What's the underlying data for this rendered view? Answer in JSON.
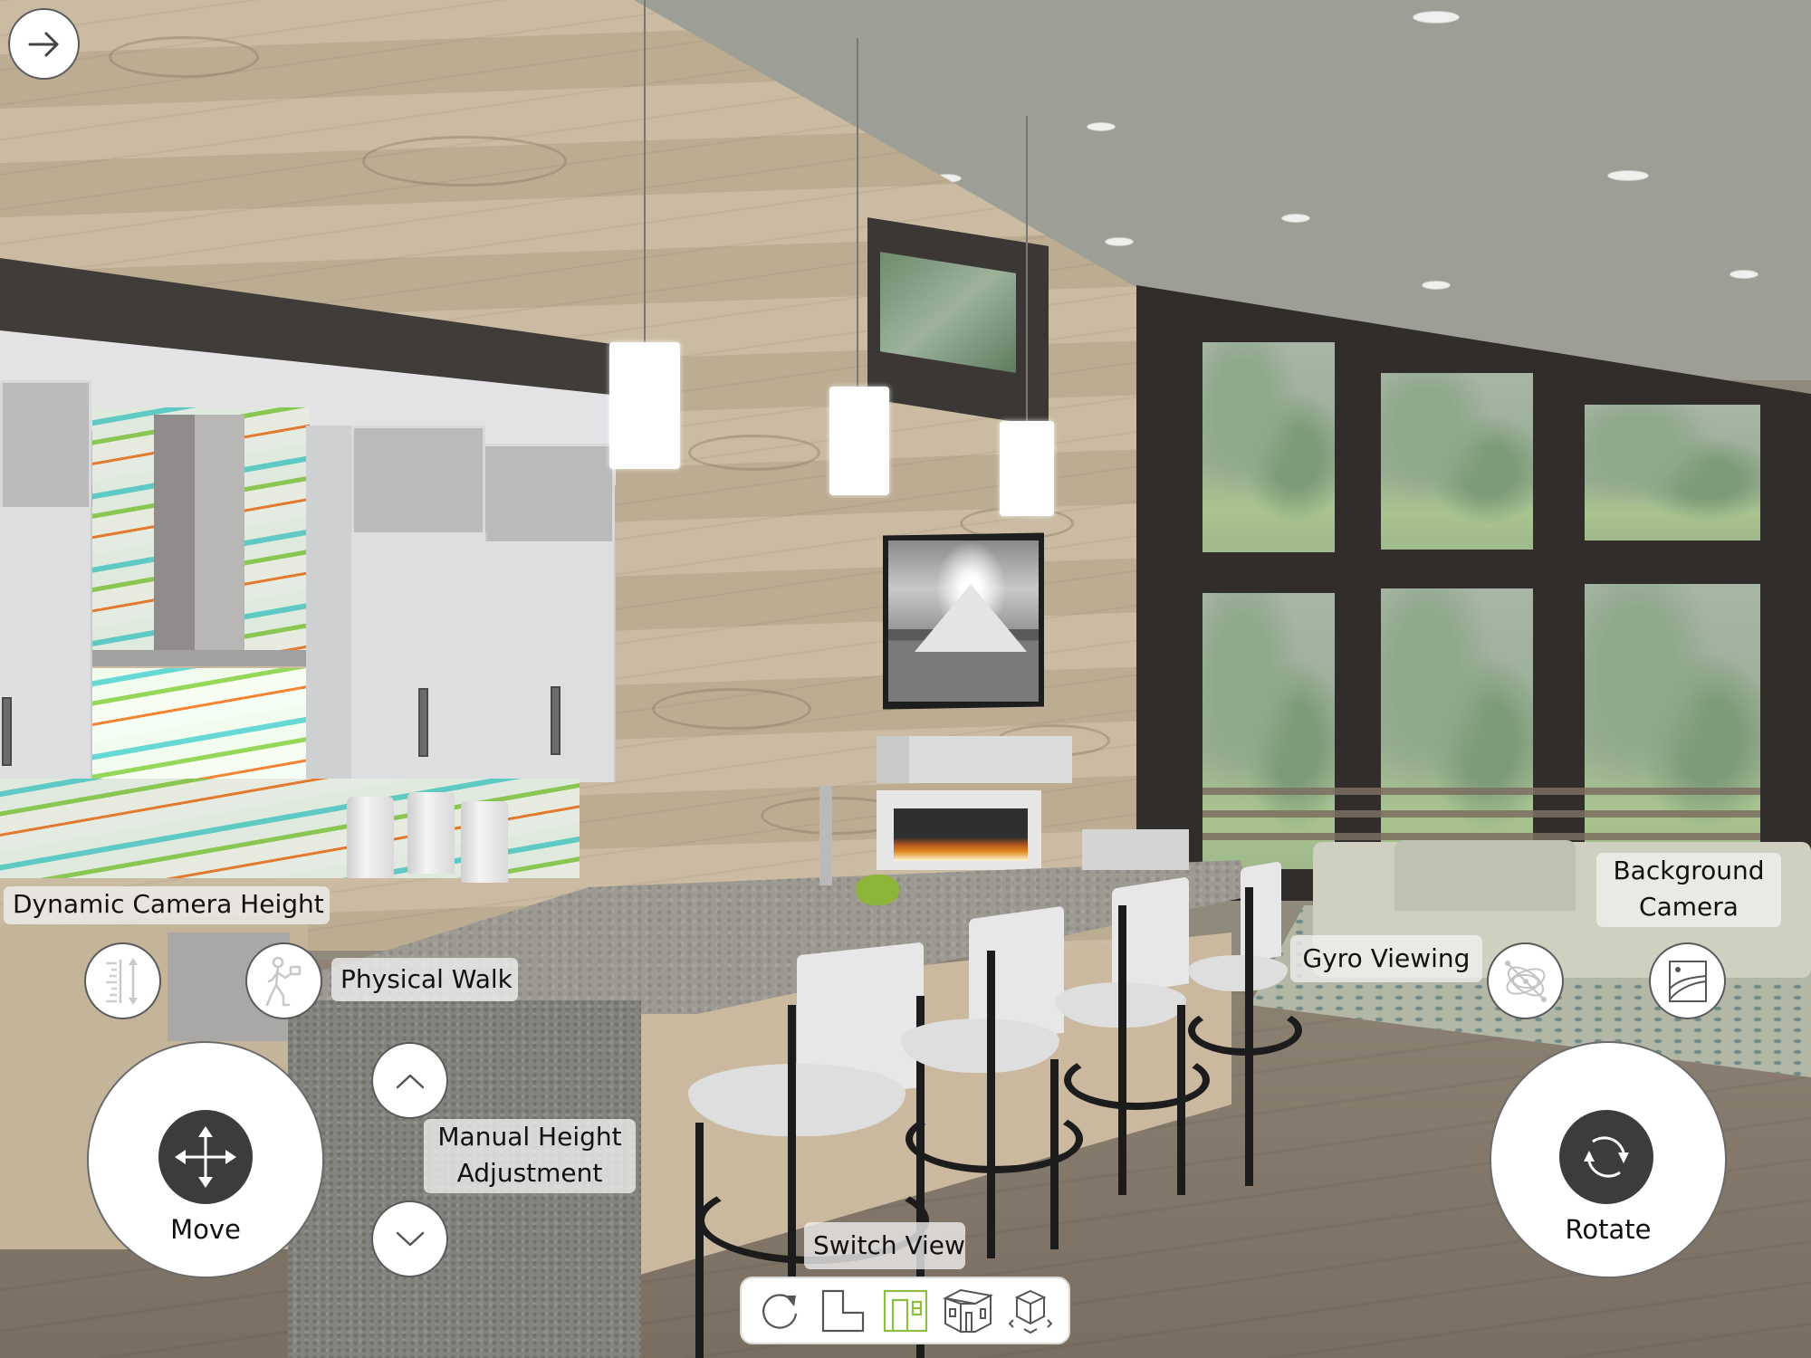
{
  "app": {
    "view_mode": "3D walkthrough",
    "scene_description": "Kitchen with island, bar stools, wood plank accent wall, fireplace, and floor-to-ceiling windows"
  },
  "nav": {
    "back_button_icon": "arrow-right-icon"
  },
  "controls": {
    "dynamic_camera_height": {
      "label": "Dynamic Camera Height",
      "icon": "height-ruler-icon"
    },
    "physical_walk": {
      "label": "Physical Walk",
      "icon": "walking-person-icon"
    },
    "move": {
      "label": "Move",
      "icon": "move-arrows-icon"
    },
    "manual_height": {
      "label_line1": "Manual Height",
      "label_line2": "Adjustment",
      "up_icon": "chevron-up-icon",
      "down_icon": "chevron-down-icon"
    },
    "switch_view": {
      "label": "Switch View",
      "views": [
        {
          "name": "reset-view",
          "icon": "rotate-reset-icon",
          "active": false
        },
        {
          "name": "floor-plan",
          "icon": "floor-plan-icon",
          "active": false
        },
        {
          "name": "elevation",
          "icon": "elevation-icon",
          "active": true
        },
        {
          "name": "3d-house",
          "icon": "house-3d-icon",
          "active": false
        },
        {
          "name": "3d-object",
          "icon": "cube-3d-icon",
          "active": false
        }
      ],
      "active_color": "#8cbf3f",
      "inactive_color": "#555555"
    },
    "gyro_viewing": {
      "label": "Gyro Viewing",
      "icon": "gyroscope-icon"
    },
    "background_camera": {
      "label_line1": "Background",
      "label_line2": "Camera",
      "icon": "landscape-image-icon"
    },
    "rotate": {
      "label": "Rotate",
      "icon": "rotate-arrows-icon"
    }
  },
  "colors": {
    "button_bg": "#ffffff",
    "icon_dark": "#3c3c3c",
    "label_bg": "#f0f0f0",
    "accent_green": "#8cbf3f"
  }
}
